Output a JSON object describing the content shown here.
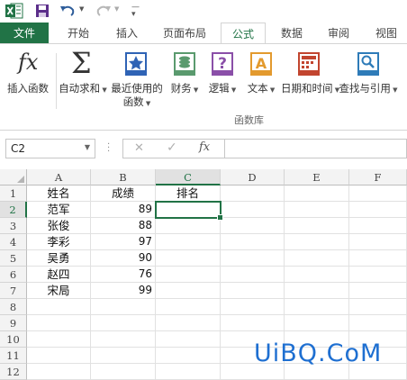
{
  "quick_access": {
    "save_icon": "save-icon",
    "undo_icon": "undo-icon",
    "redo_icon": "redo-icon",
    "customize_icon": "customize-qat-icon"
  },
  "tabs": [
    {
      "label": "文件",
      "kind": "file"
    },
    {
      "label": "开始"
    },
    {
      "label": "插入"
    },
    {
      "label": "页面布局"
    },
    {
      "label": "公式",
      "active": true
    },
    {
      "label": "数据"
    },
    {
      "label": "审阅"
    },
    {
      "label": "视图"
    }
  ],
  "ribbon": {
    "insert_function": "插入函数",
    "autosum": "自动求和",
    "recent_line1": "最近使用的",
    "recent_line2": "函数",
    "financial": "财务",
    "logical": "逻辑",
    "text": "文本",
    "datetime": "日期和时间",
    "lookup": "查找与引用",
    "group_label": "函数库",
    "fx_glyph": "fx",
    "sigma_glyph": "Σ"
  },
  "formula_bar": {
    "name_box": "C2",
    "cancel": "✕",
    "enter": "✓",
    "fx": "fx",
    "value": ""
  },
  "grid": {
    "columns": [
      "A",
      "B",
      "C",
      "D",
      "E",
      "F"
    ],
    "rows": [
      "1",
      "2",
      "3",
      "4",
      "5",
      "6",
      "7",
      "8",
      "9",
      "10",
      "11",
      "12"
    ],
    "header_row": {
      "a": "姓名",
      "b": "成绩",
      "c": "排名"
    },
    "data": [
      {
        "name": "范军",
        "score": "89"
      },
      {
        "name": "张俊",
        "score": "88"
      },
      {
        "name": "李彩",
        "score": "97"
      },
      {
        "name": "吴勇",
        "score": "90"
      },
      {
        "name": "赵四",
        "score": "76"
      },
      {
        "name": "宋局",
        "score": "99"
      }
    ],
    "selected_cell": "C2"
  },
  "watermark": "UiBQ.CoM",
  "colors": {
    "accent": "#217346",
    "watermark": "#1e6fd1"
  }
}
